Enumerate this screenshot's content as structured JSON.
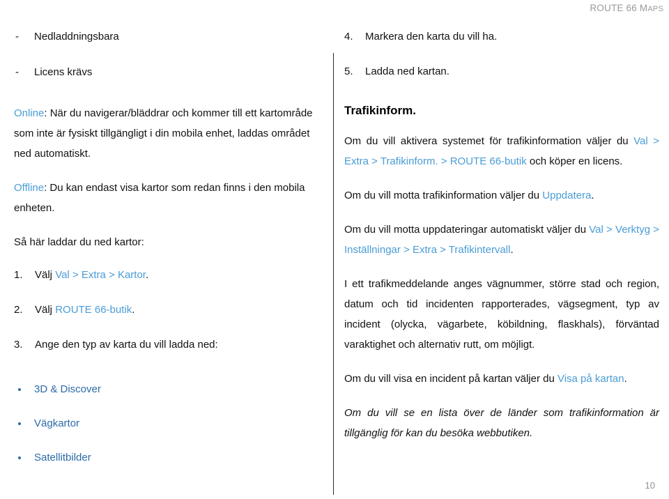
{
  "header": {
    "brand_major": "ROUTE 66 ",
    "brand_minor_m": "M",
    "brand_minor_rest": "APS"
  },
  "colors": {
    "link_light": "#4a9cd6",
    "link_dark": "#2c6ba8",
    "header_gray": "#9a9a9a",
    "body_text": "#111111",
    "divider": "#2b2b2b"
  },
  "left_column": {
    "dash_items": [
      {
        "dash": "-",
        "text": "Nedladdningsbara"
      },
      {
        "dash": "-",
        "text": "Licens krävs"
      }
    ],
    "paragraph_online": {
      "link": "Online",
      "rest": ": När du navigerar/bläddrar och kommer till ett kartområde som inte är fysiskt tillgängligt i din mobila enhet, laddas området ned automatiskt."
    },
    "paragraph_offline": {
      "link": "Offline",
      "rest": ": Du kan endast visa kartor som redan finns i den mobila enheten."
    },
    "intro_download": "Så här laddar du ned kartor:",
    "numbered_items": [
      {
        "num": "1.",
        "prefix": "Välj ",
        "link": "Val > Extra > Kartor",
        "suffix": "."
      },
      {
        "num": "2.",
        "prefix": "Välj ",
        "link": "ROUTE 66-butik",
        "suffix": "."
      },
      {
        "num": "3.",
        "prefix": "Ange den typ av karta du vill ladda ned:",
        "link": "",
        "suffix": ""
      }
    ],
    "bullet_items": [
      {
        "text": "3D & Discover"
      },
      {
        "text": "Vägkartor"
      },
      {
        "text": "Satellitbilder"
      }
    ]
  },
  "right_column": {
    "numbered_items": [
      {
        "num": "4.",
        "text": "Markera den karta du vill ha."
      },
      {
        "num": "5.",
        "text": "Ladda ned kartan."
      }
    ],
    "heading": "Trafikinform.",
    "paragraph_activate": {
      "prefix": "Om du vill aktivera systemet för trafikinformation väljer du ",
      "link": "Val > Extra > Trafikinform. > ROUTE 66-butik",
      "suffix": " och köper en licens."
    },
    "paragraph_receive": {
      "prefix": "Om du vill motta trafikinformation väljer du ",
      "link": "Uppdatera",
      "suffix": "."
    },
    "paragraph_auto_updates": {
      "prefix": "Om du vill motta uppdateringar automatiskt väljer du ",
      "link": "Val > Verktyg > Inställningar > Extra > Trafikintervall",
      "suffix": "."
    },
    "paragraph_message_contents": "I ett trafikmeddelande anges vägnummer, större stad och region, datum och tid incidenten rapporterades, vägsegment, typ av incident (olycka, vägarbete, köbildning, flaskhals), förväntad varaktighet och alternativ rutt, om möjligt.",
    "paragraph_show_on_map": {
      "prefix": "Om du vill visa en incident på kartan väljer du ",
      "link": "Visa på kartan",
      "suffix": "."
    },
    "paragraph_country_list": "Om du vill se en lista över de länder som trafikinformation är tillgänglig för kan du besöka webbutiken."
  },
  "footer": {
    "page_number": "10"
  }
}
